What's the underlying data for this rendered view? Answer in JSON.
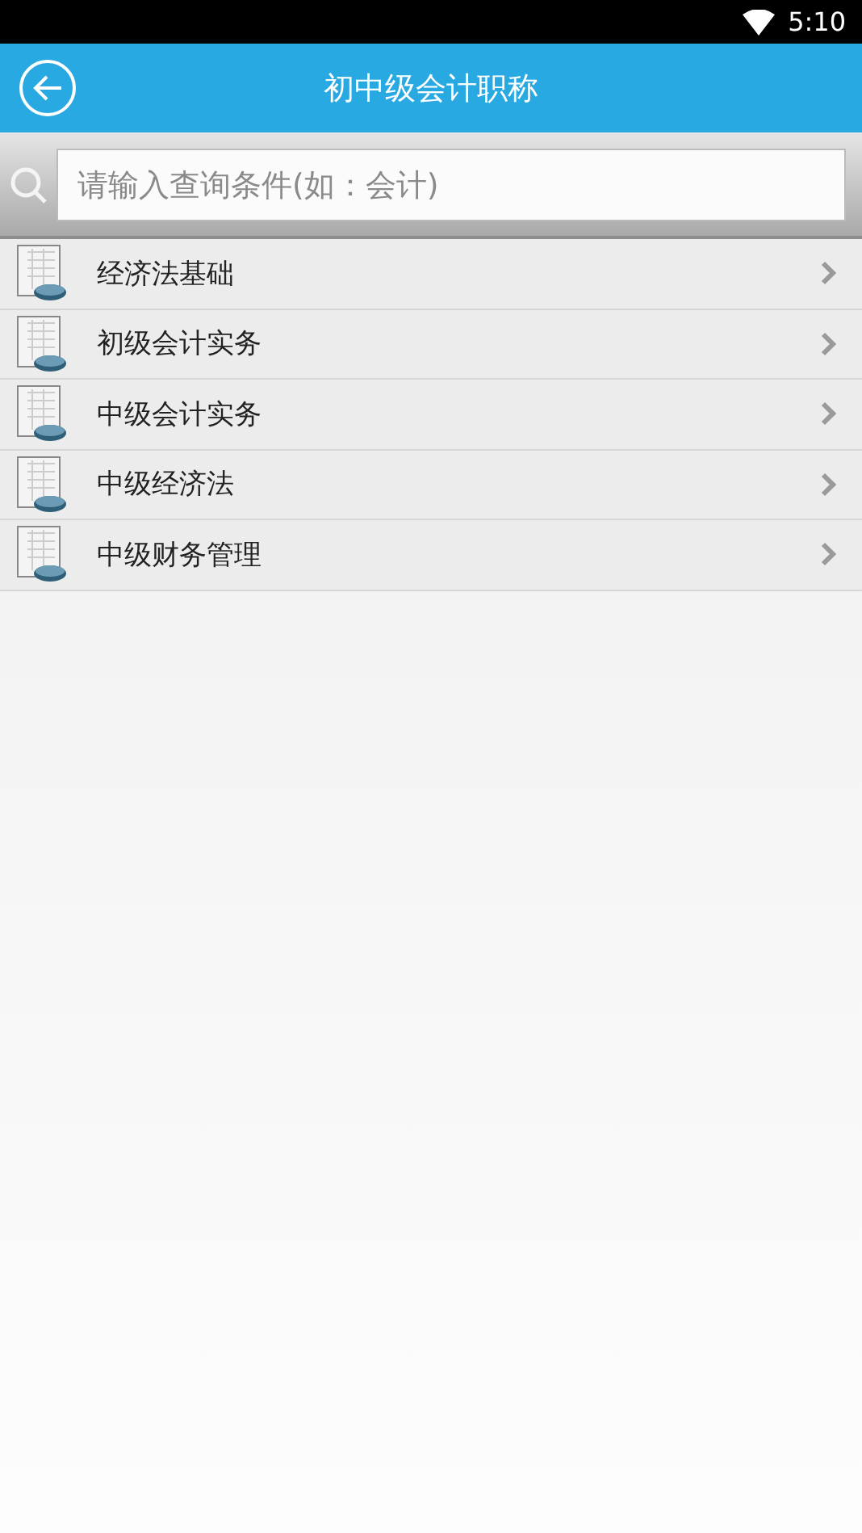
{
  "status_bar": {
    "time": "5:10"
  },
  "header": {
    "title": "初中级会计职称"
  },
  "search": {
    "placeholder": "请输入查询条件(如：会计)"
  },
  "items": [
    {
      "label": "经济法基础"
    },
    {
      "label": "初级会计实务"
    },
    {
      "label": "中级会计实务"
    },
    {
      "label": "中级经济法"
    },
    {
      "label": "中级财务管理"
    }
  ]
}
